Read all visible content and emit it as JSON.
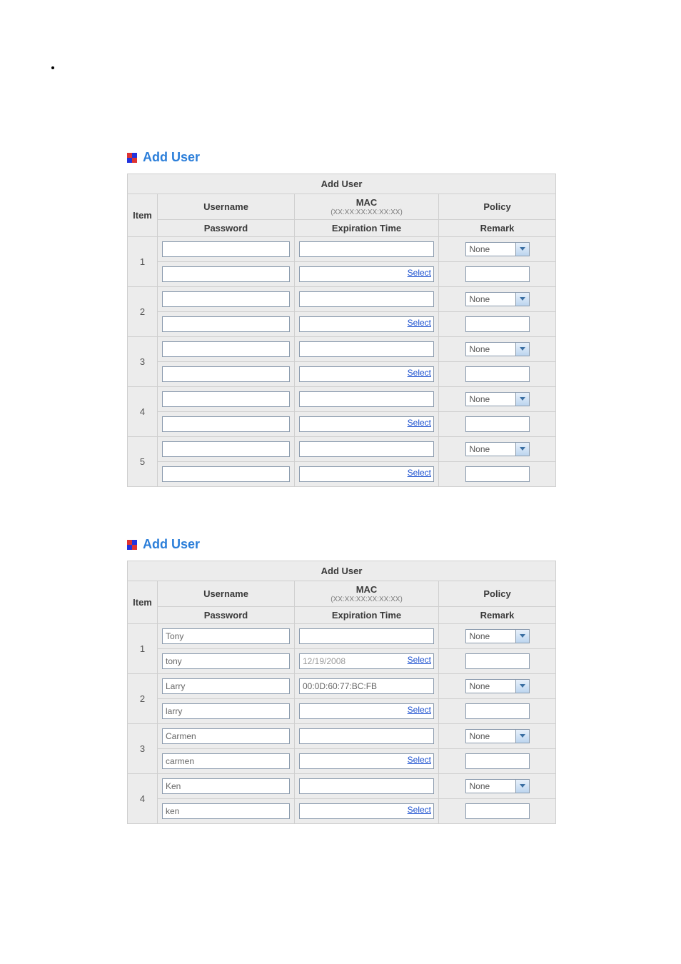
{
  "heading": "Add User",
  "tableTitle": "Add User",
  "headers": {
    "item": "Item",
    "username": "Username",
    "mac": "MAC",
    "macHint": "(XX:XX:XX:XX:XX:XX)",
    "policy": "Policy",
    "password": "Password",
    "expiration": "Expiration Time",
    "remark": "Remark"
  },
  "selectLabel": "Select",
  "policyDefault": "None",
  "table1_rows": [
    {
      "item": "1",
      "username": "",
      "password": "",
      "mac": "",
      "expiration": "",
      "policy": "None",
      "remark": ""
    },
    {
      "item": "2",
      "username": "",
      "password": "",
      "mac": "",
      "expiration": "",
      "policy": "None",
      "remark": ""
    },
    {
      "item": "3",
      "username": "",
      "password": "",
      "mac": "",
      "expiration": "",
      "policy": "None",
      "remark": ""
    },
    {
      "item": "4",
      "username": "",
      "password": "",
      "mac": "",
      "expiration": "",
      "policy": "None",
      "remark": ""
    },
    {
      "item": "5",
      "username": "",
      "password": "",
      "mac": "",
      "expiration": "",
      "policy": "None",
      "remark": ""
    }
  ],
  "table2_rows": [
    {
      "item": "1",
      "username": "Tony",
      "password": "tony",
      "mac": "",
      "expiration": "12/19/2008",
      "policy": "None",
      "remark": ""
    },
    {
      "item": "2",
      "username": "Larry",
      "password": "larry",
      "mac": "00:0D:60:77:BC:FB",
      "expiration": "",
      "policy": "None",
      "remark": ""
    },
    {
      "item": "3",
      "username": "Carmen",
      "password": "carmen",
      "mac": "",
      "expiration": "",
      "policy": "None",
      "remark": ""
    },
    {
      "item": "4",
      "username": "Ken",
      "password": "ken",
      "mac": "",
      "expiration": "",
      "policy": "None",
      "remark": ""
    }
  ]
}
